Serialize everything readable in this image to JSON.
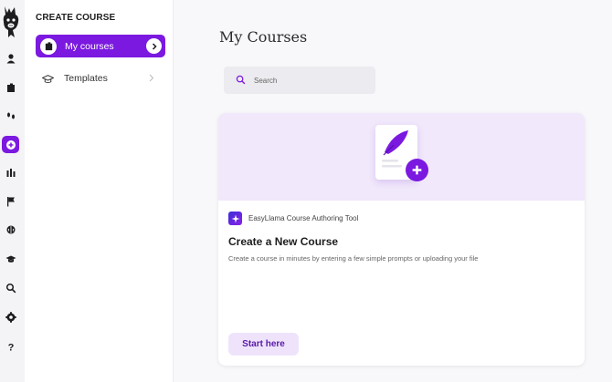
{
  "sidebar": {
    "section_title": "CREATE COURSE",
    "items": [
      {
        "label": "My courses",
        "active": true
      },
      {
        "label": "Templates",
        "active": false
      }
    ]
  },
  "rail": {
    "icons": [
      "user-icon",
      "course-icon",
      "footprints-icon",
      "create-icon",
      "analytics-icon",
      "flag-icon",
      "brain-icon",
      "graduation-cap-icon",
      "search-icon",
      "settings-icon",
      "help-icon"
    ],
    "active": "create-icon"
  },
  "main": {
    "title": "My Courses",
    "search_placeholder": "Search"
  },
  "card": {
    "tool_name": "EasyLlama Course Authoring Tool",
    "title": "Create a New Course",
    "description": "Create a course in minutes by entering a few simple prompts or uploading your file",
    "button_label": "Start here"
  },
  "colors": {
    "accent": "#7b19e0",
    "hero_bg": "#f1e8fb",
    "button_bg": "#efe3fc"
  }
}
